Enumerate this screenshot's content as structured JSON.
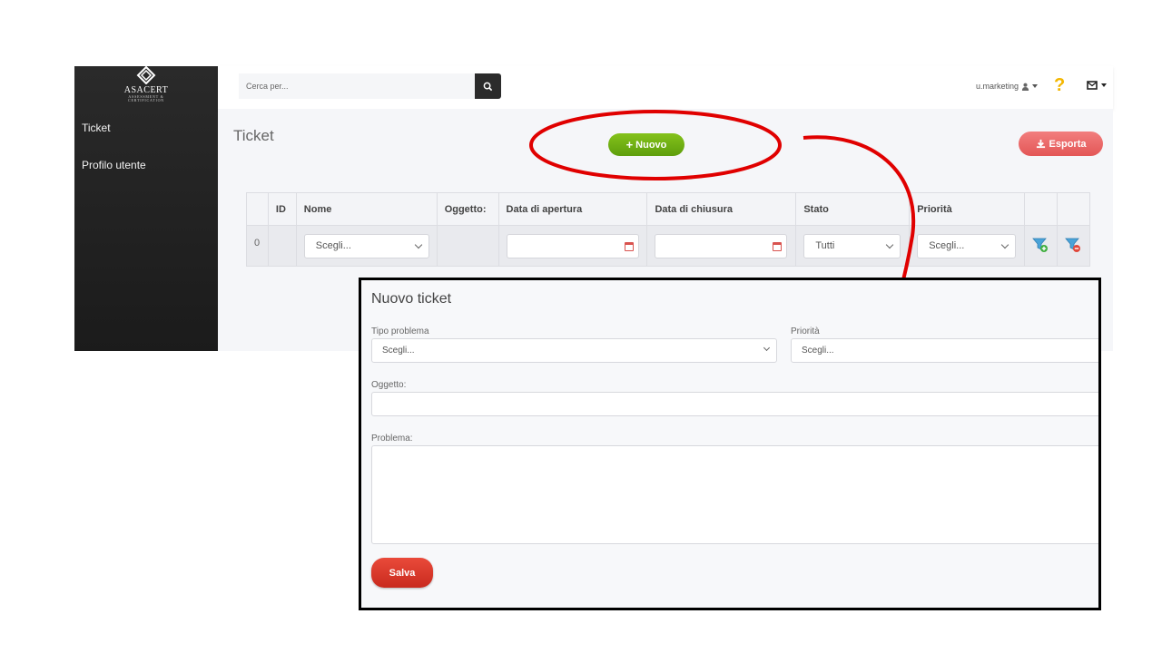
{
  "brand": {
    "name": "ASACERT",
    "tagline_line1": "ASSESSMENT &",
    "tagline_line2": "CERTIFICATION"
  },
  "sidebar": {
    "items": [
      {
        "label": "Ticket"
      },
      {
        "label": "Profilo utente"
      }
    ]
  },
  "header": {
    "search_placeholder": "Cerca per...",
    "user": "u.marketing",
    "icons": [
      "search-icon",
      "user-icon",
      "help-icon",
      "mail-icon"
    ]
  },
  "page": {
    "title": "Ticket",
    "new_button": "Nuovo",
    "export_button": "Esporta"
  },
  "table": {
    "columns": [
      "",
      "ID",
      "Nome",
      "Oggetto:",
      "Data di apertura",
      "Data di chiusura",
      "Stato",
      "Priorità",
      "",
      ""
    ],
    "filter_row": {
      "count": "0",
      "nome": "Scegli...",
      "stato": "Tutti",
      "priorita": "Scegli..."
    }
  },
  "modal": {
    "title": "Nuovo ticket",
    "tipo_problema_label": "Tipo problema",
    "tipo_problema_value": "Scegli...",
    "priorita_label": "Priorità",
    "priorita_value": "Scegli...",
    "oggetto_label": "Oggetto:",
    "problema_label": "Problema:",
    "save_button": "Salva"
  },
  "colors": {
    "sidebar": "#222222",
    "new_button": "#6fb014",
    "export_button": "#ea6a6a",
    "save_button": "#d9362a",
    "annotation": "#e00000"
  }
}
